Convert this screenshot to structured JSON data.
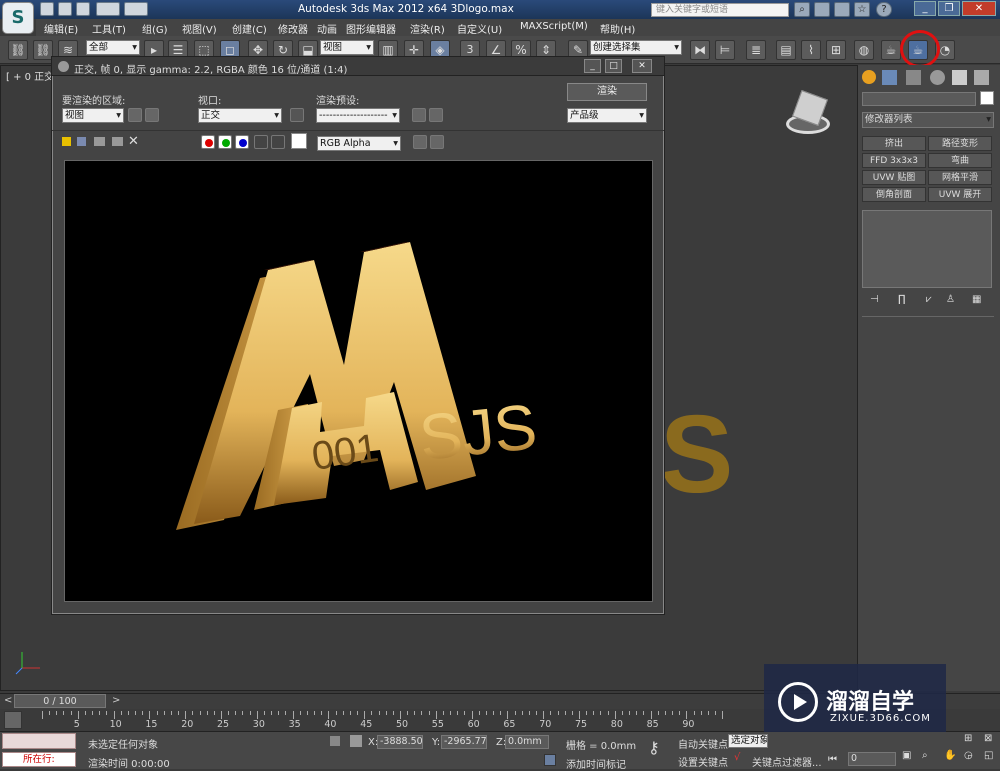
{
  "app": {
    "logo_letter": "S",
    "title": "Autodesk 3ds Max  2012 x64    3Dlogo.max",
    "search_placeholder": "键入关键字或短语",
    "help": "?"
  },
  "menu": [
    "编辑(E)",
    "工具(T)",
    "组(G)",
    "视图(V)",
    "创建(C)",
    "修改器",
    "动画",
    "图形编辑器",
    "渲染(R)",
    "自定义(U)",
    "MAXScript(M)",
    "帮助(H)"
  ],
  "toolbar": {
    "filter": "全部",
    "coord": "视图",
    "named_selection": "创建选择集",
    "snap_label": "3",
    "percent_label": "%"
  },
  "viewport": {
    "label": "[ + 0 正交"
  },
  "render_window": {
    "title": "正交, 帧 0, 显示 gamma: 2.2, RGBA 颜色 16 位/通道 (1:4)",
    "area_label": "要渲染的区域:",
    "area_value": "视图",
    "viewport_label": "视口:",
    "viewport_value": "正交",
    "preset_label": "渲染预设:",
    "preset_value": "--------------------",
    "render_button": "渲染",
    "quality_value": "产品级",
    "channel_value": "RGB Alpha",
    "logo_text": "M",
    "logo_code": "001",
    "logo_sub": "SJS"
  },
  "command_panel": {
    "modifier_list": "修改器列表",
    "buttons": [
      "挤出",
      "路径变形",
      "FFD 3x3x3",
      "弯曲",
      "UVW 贴图",
      "网格平滑",
      "倒角剖面",
      "UVW 展开"
    ]
  },
  "timeline": {
    "frame": "0 / 100",
    "ticks": [
      "5",
      "10",
      "15",
      "20",
      "25",
      "30",
      "35",
      "40",
      "45",
      "50",
      "55",
      "60",
      "65",
      "70",
      "75",
      "80",
      "85",
      "90"
    ]
  },
  "status": {
    "running": "所在行:",
    "message": "未选定任何对象",
    "render_time": "渲染时间  0:00:00",
    "x_label": "X:",
    "x_value": "-3888.501",
    "y_label": "Y:",
    "y_value": "-2965.772",
    "z_label": "Z:",
    "z_value": "0.0mm",
    "grid": "栅格 = 0.0mm",
    "add_time_tag": "添加时间标记",
    "auto_key": "自动关键点",
    "selected": "选定对象",
    "set_key": "设置关键点",
    "key_filters": "关键点过滤器...",
    "frame_field": "0"
  },
  "watermark": {
    "brand": "溜溜自学",
    "url": "ZIXUE.3D66.COM"
  }
}
